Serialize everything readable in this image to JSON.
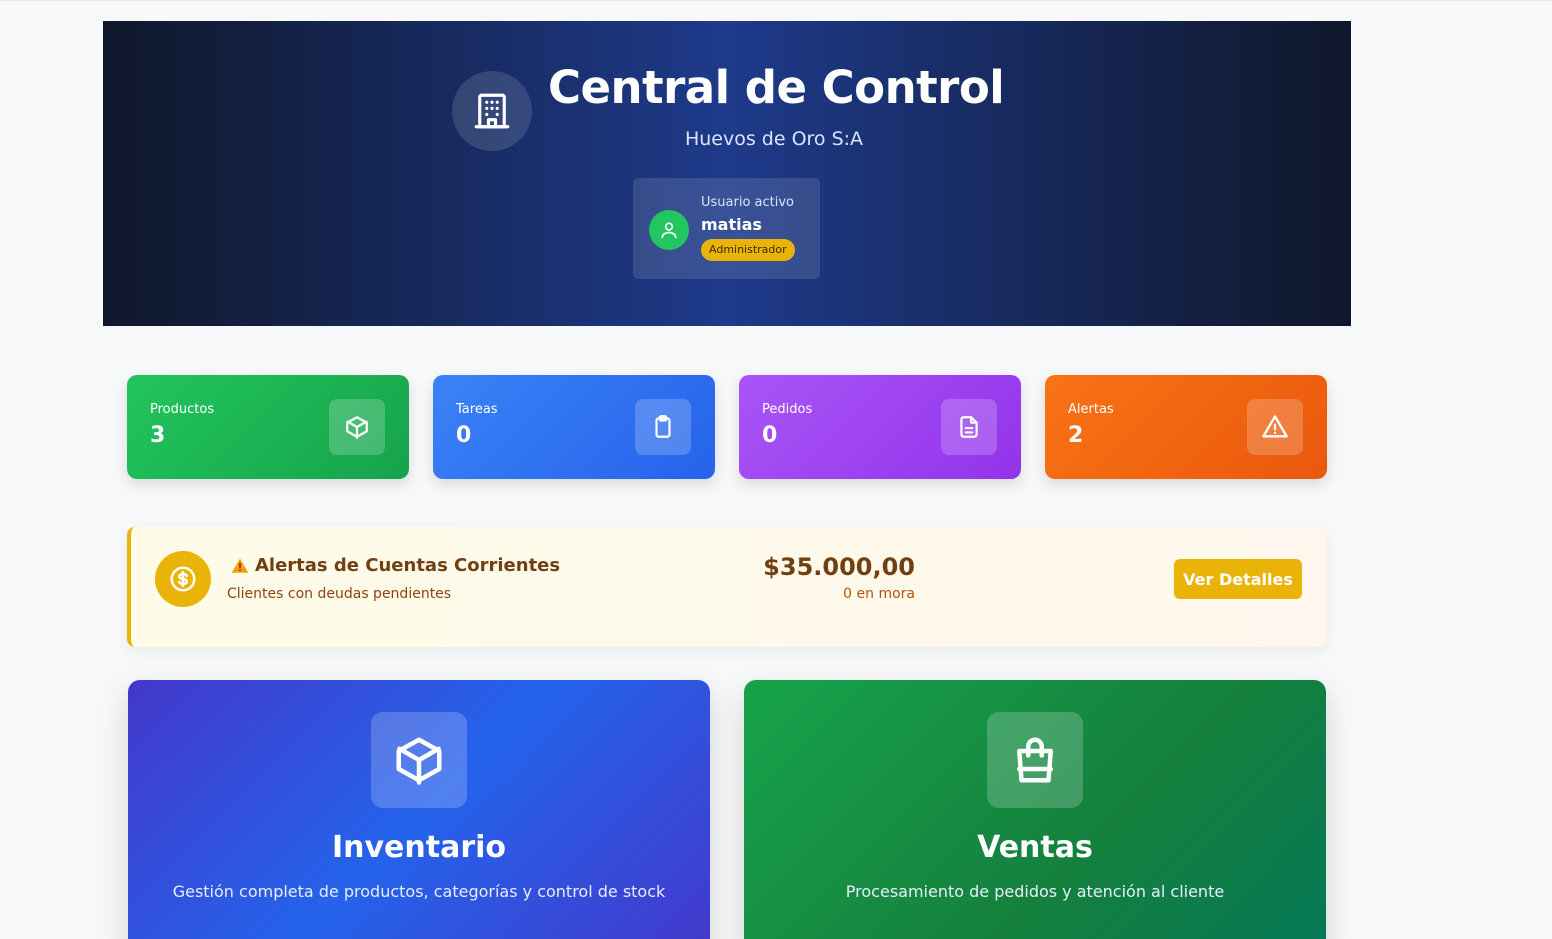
{
  "header": {
    "title": "Central de Control",
    "subtitle": "Huevos de Oro S:A",
    "icon": "building-icon",
    "user": {
      "caption": "Usuario activo",
      "name": "matias",
      "role": "Administrador"
    }
  },
  "stats": [
    {
      "label": "Productos",
      "value": "3",
      "icon": "box-icon",
      "color": "#22c55e"
    },
    {
      "label": "Tareas",
      "value": "0",
      "icon": "clipboard-icon",
      "color": "#3b82f6"
    },
    {
      "label": "Pedidos",
      "value": "0",
      "icon": "document-icon",
      "color": "#a855f7"
    },
    {
      "label": "Alertas",
      "value": "2",
      "icon": "warning-icon",
      "color": "#f97316"
    }
  ],
  "alert": {
    "title": "Alertas de Cuentas Corrientes",
    "subtitle": "Clientes con deudas pendientes",
    "amount": "$35.000,00",
    "mora": "0 en mora",
    "button": "Ver Detalles",
    "color": "#eab308"
  },
  "modules": [
    {
      "title": "Inventario",
      "description": "Gestión completa de productos, categorías y control de stock",
      "icon": "box-icon"
    },
    {
      "title": "Ventas",
      "description": "Procesamiento de pedidos y atención al cliente",
      "icon": "shopping-bag-icon"
    }
  ]
}
